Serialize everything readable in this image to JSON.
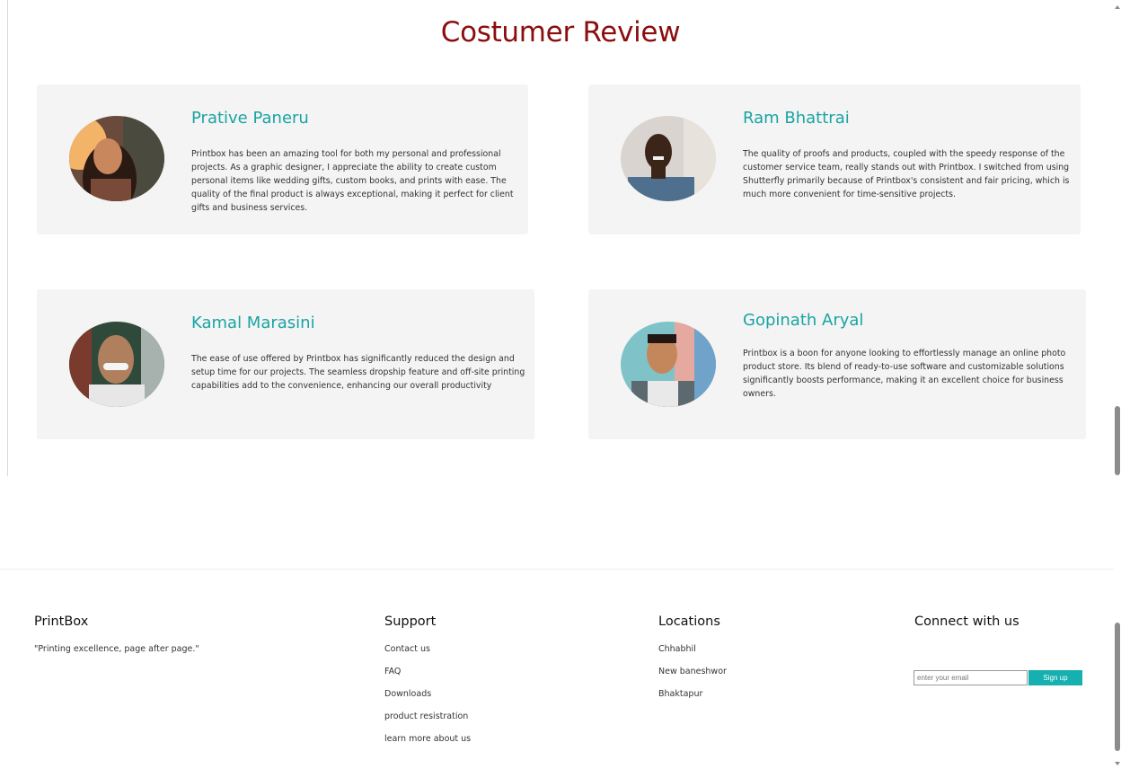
{
  "reviews": {
    "title": "Costumer Review",
    "items": [
      {
        "name": "Prative Paneru",
        "text": "Printbox has been an amazing tool for both my personal and professional projects. As a graphic designer, I appreciate the ability to create custom personal items like wedding gifts, custom books, and prints with ease. The quality of the final product is always exceptional, making it perfect for client gifts and business services."
      },
      {
        "name": "Ram Bhattrai",
        "text": "The quality of proofs and products, coupled with the speedy response of the customer service team, really stands out with Printbox. I switched from using Shutterfly primarily because of Printbox's consistent and fair pricing, which is much more convenient for time-sensitive projects."
      },
      {
        "name": "Kamal Marasini",
        "text": "The ease of use offered by Printbox has significantly reduced the design and setup time for our projects. The seamless dropship feature and off-site printing capabilities add to the convenience, enhancing our overall productivity"
      },
      {
        "name": "Gopinath Aryal",
        "text": "Printbox is a boon for anyone looking to effortlessly manage an online photo product store. Its blend of ready-to-use software and customizable solutions significantly boosts performance, making it an excellent choice for business owners."
      }
    ]
  },
  "footer": {
    "brand": "PrintBox",
    "tagline": "\"Printing excellence, page after page.\"",
    "support": {
      "heading": "Support",
      "links": [
        "Contact us",
        "FAQ",
        "Downloads",
        "product resistration",
        "learn more about us"
      ]
    },
    "locations": {
      "heading": "Locations",
      "items": [
        "Chhabhil",
        "New baneshwor",
        "Bhaktapur"
      ]
    },
    "connect": {
      "heading": "Connect with us",
      "email_placeholder": "enter your email",
      "email_value": "",
      "signup_label": "Sign up"
    }
  },
  "colors": {
    "title": "#8b0e0e",
    "accent": "#1aa3a3",
    "card_bg": "#f4f4f4",
    "button": "#17b0b0"
  }
}
